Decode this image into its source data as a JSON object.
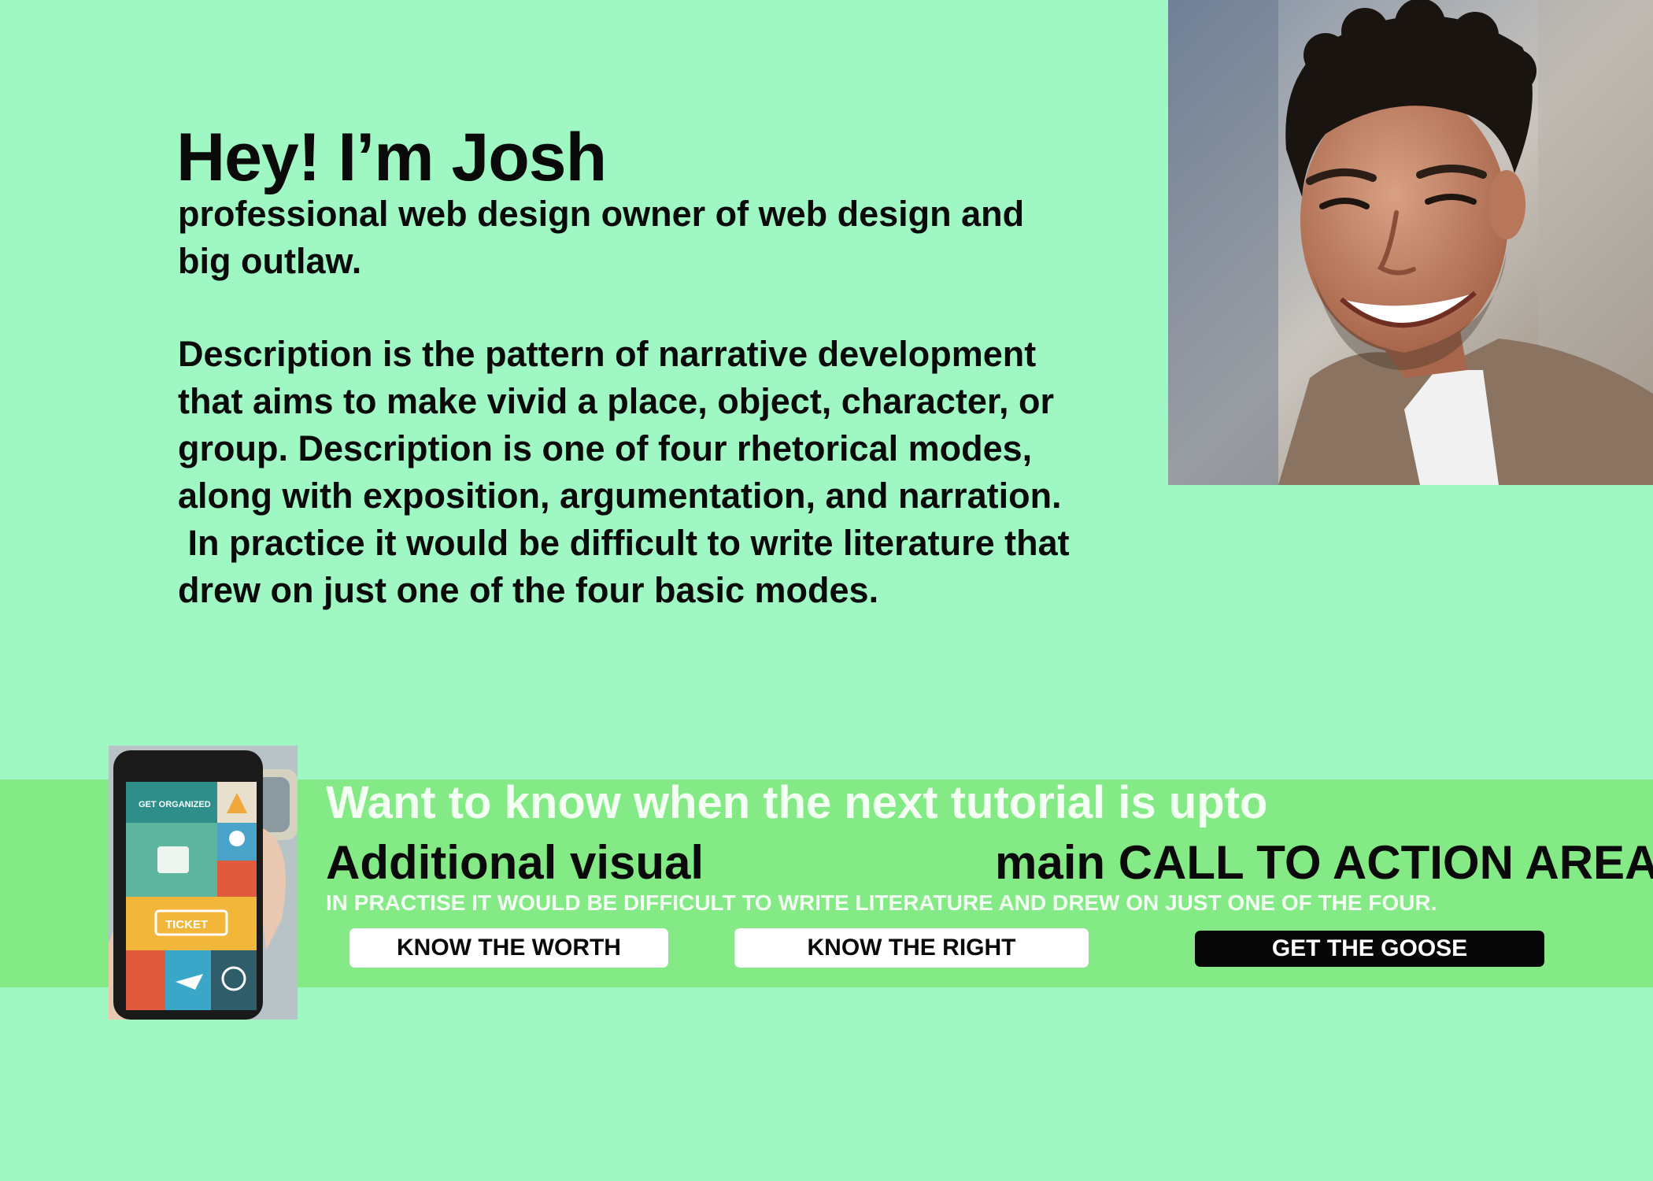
{
  "hero": {
    "title": "Hey! I’m Josh",
    "subtitle": "professional web design owner of web design and big outlaw.",
    "description_lines": [
      "Description is the pattern of narrative development",
      "that aims to make vivid a place, object, character, or",
      "group. Description is one of four rhetorical modes,",
      "along with exposition, argumentation, and narration.",
      " In practice it would be difficult to write literature that",
      "drew on just one of the four basic modes."
    ]
  },
  "portrait": {
    "icon": "smiling-man-portrait"
  },
  "cta": {
    "heading": "Want to know when the next tutorial is upto",
    "left_label": "Additional visual",
    "right_label": "main CALL TO ACTION AREA",
    "note": "IN PRACTISE IT WOULD BE DIFFICULT TO WRITE LITERATURE AND  DREW ON JUST ONE OF THE FOUR.",
    "buttons": [
      {
        "label": "KNOW THE WORTH"
      },
      {
        "label": "KNOW THE RIGHT"
      },
      {
        "label": "GET THE GOOSE"
      }
    ]
  },
  "phone_visual": {
    "icon": "phone-app-icon",
    "screen_title": "GET ORGANIZED",
    "ticket_label": "TICKET"
  },
  "colors": {
    "background": "#9ff7c3",
    "band": "#84ea85",
    "button_dark": "#070707",
    "button_light": "#ffffff"
  }
}
